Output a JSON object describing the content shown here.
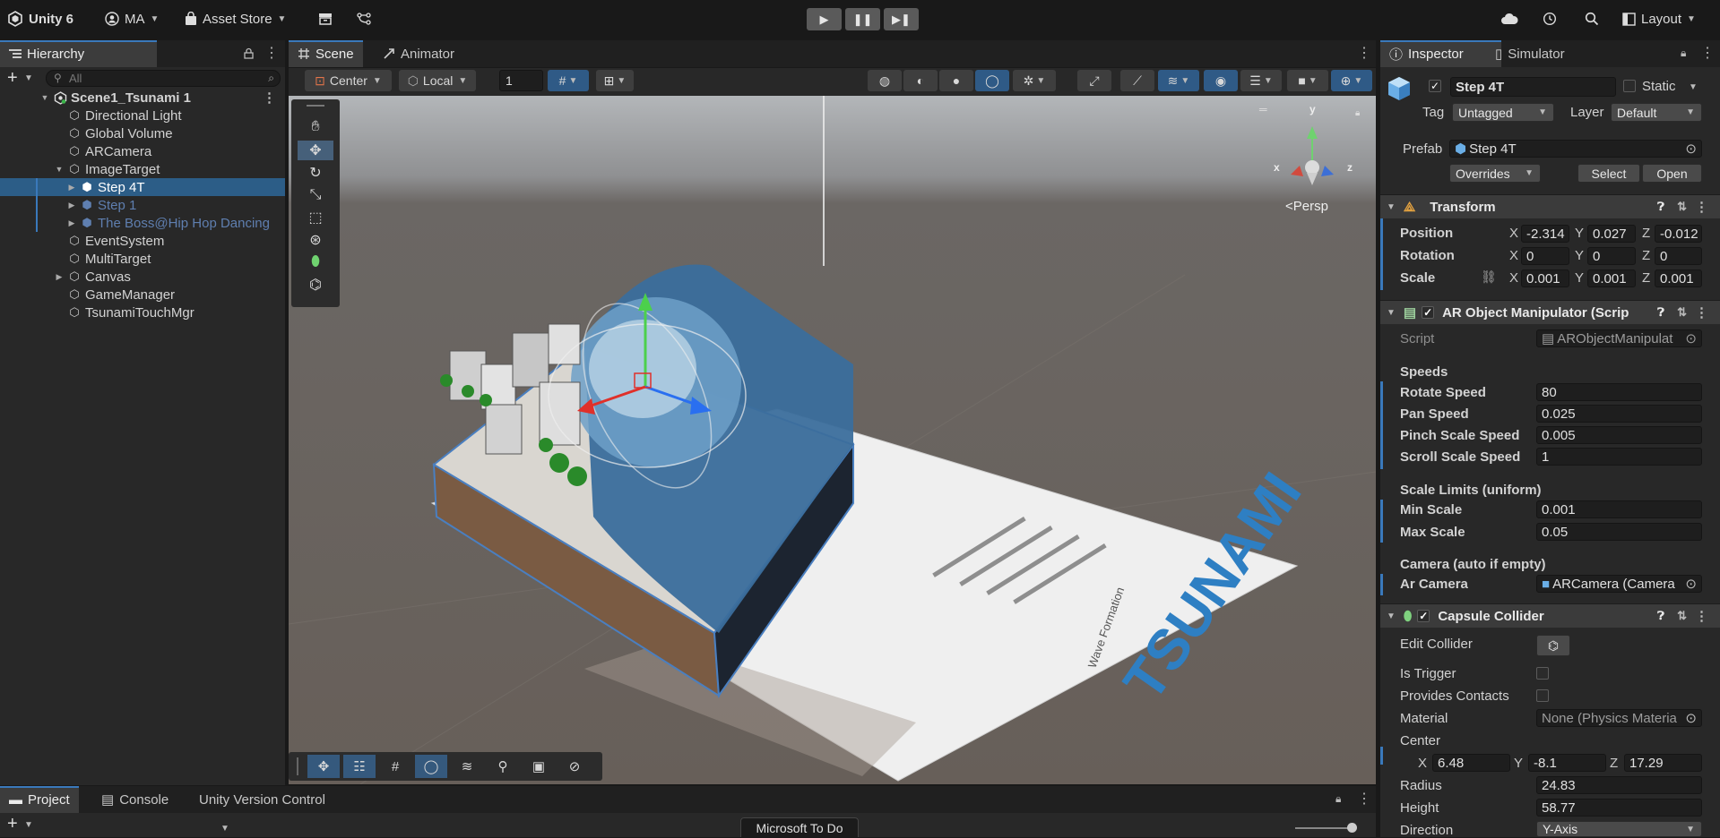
{
  "app": {
    "title": "Unity 6",
    "account": "MA",
    "asset_store": "Asset Store",
    "layout": "Layout"
  },
  "hierarchy": {
    "tab": "Hierarchy",
    "search_placeholder": "All",
    "scene_name": "Scene1_Tsunami 1",
    "items": [
      {
        "label": "Directional Light"
      },
      {
        "label": "Global Volume"
      },
      {
        "label": "ARCamera"
      },
      {
        "label": "ImageTarget"
      },
      {
        "label": "Step 4T"
      },
      {
        "label": "Step 1"
      },
      {
        "label": "The Boss@Hip Hop Dancing"
      },
      {
        "label": "EventSystem"
      },
      {
        "label": "MultiTarget"
      },
      {
        "label": "Canvas"
      },
      {
        "label": "GameManager"
      },
      {
        "label": "TsunamiTouchMgr"
      }
    ]
  },
  "scene": {
    "tabs": [
      "Scene",
      "Animator"
    ],
    "pivot": "Center",
    "space": "Local",
    "grid_value": "1",
    "persp_label": "Persp",
    "gizmo_axes": {
      "x": "x",
      "y": "y",
      "z": "z"
    },
    "paper_title": "TSUNAMI",
    "paper_caption": "Wave Formation"
  },
  "bottom": {
    "tabs": [
      "Project",
      "Console",
      "Unity Version Control"
    ],
    "tooltip": "Microsoft To Do"
  },
  "inspector": {
    "tabs": [
      "Inspector",
      "Simulator"
    ],
    "object_name": "Step 4T",
    "static_label": "Static",
    "tag_label": "Tag",
    "tag_value": "Untagged",
    "layer_label": "Layer",
    "layer_value": "Default",
    "prefab_label": "Prefab",
    "prefab_value": "Step 4T",
    "overrides": "Overrides",
    "select": "Select",
    "open": "Open",
    "transform": {
      "title": "Transform",
      "rows": [
        {
          "label": "Position",
          "x": "-2.314",
          "y": "0.027",
          "z": "-0.012"
        },
        {
          "label": "Rotation",
          "x": "0",
          "y": "0",
          "z": "0"
        },
        {
          "label": "Scale",
          "x": "0.001",
          "y": "0.001",
          "z": "0.001"
        }
      ]
    },
    "ar_manip": {
      "title": "AR Object Manipulator (Scrip",
      "script_label": "Script",
      "script_value": "ARObjectManipulat",
      "speeds_header": "Speeds",
      "rotate_label": "Rotate Speed",
      "rotate_value": "80",
      "pan_label": "Pan Speed",
      "pan_value": "0.025",
      "pinch_label": "Pinch Scale Speed",
      "pinch_value": "0.005",
      "scroll_label": "Scroll Scale Speed",
      "scroll_value": "1",
      "limits_header": "Scale Limits (uniform)",
      "min_label": "Min Scale",
      "min_value": "0.001",
      "max_label": "Max Scale",
      "max_value": "0.05",
      "camera_header": "Camera (auto if empty)",
      "cam_label": "Ar Camera",
      "cam_value": "ARCamera (Camera"
    },
    "capsule": {
      "title": "Capsule Collider",
      "edit_label": "Edit Collider",
      "trigger_label": "Is Trigger",
      "contacts_label": "Provides Contacts",
      "material_label": "Material",
      "material_value": "None (Physics Materia",
      "center_label": "Center",
      "cx": "6.48",
      "cy": "-8.1",
      "cz": "17.29",
      "radius_label": "Radius",
      "radius_value": "24.83",
      "height_label": "Height",
      "height_value": "58.77",
      "direction_label": "Direction",
      "direction_value": "Y-Axis"
    }
  },
  "colors": {
    "accent": "#3a79bb",
    "selection": "#2c5d87",
    "panel": "#282828"
  }
}
